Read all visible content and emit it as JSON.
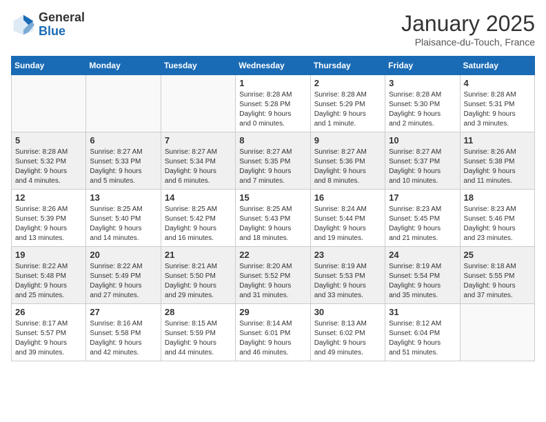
{
  "header": {
    "logo_general": "General",
    "logo_blue": "Blue",
    "month_title": "January 2025",
    "location": "Plaisance-du-Touch, France"
  },
  "days_of_week": [
    "Sunday",
    "Monday",
    "Tuesday",
    "Wednesday",
    "Thursday",
    "Friday",
    "Saturday"
  ],
  "weeks": [
    [
      {
        "day": "",
        "content": ""
      },
      {
        "day": "",
        "content": ""
      },
      {
        "day": "",
        "content": ""
      },
      {
        "day": "1",
        "content": "Sunrise: 8:28 AM\nSunset: 5:28 PM\nDaylight: 9 hours\nand 0 minutes."
      },
      {
        "day": "2",
        "content": "Sunrise: 8:28 AM\nSunset: 5:29 PM\nDaylight: 9 hours\nand 1 minute."
      },
      {
        "day": "3",
        "content": "Sunrise: 8:28 AM\nSunset: 5:30 PM\nDaylight: 9 hours\nand 2 minutes."
      },
      {
        "day": "4",
        "content": "Sunrise: 8:28 AM\nSunset: 5:31 PM\nDaylight: 9 hours\nand 3 minutes."
      }
    ],
    [
      {
        "day": "5",
        "content": "Sunrise: 8:28 AM\nSunset: 5:32 PM\nDaylight: 9 hours\nand 4 minutes."
      },
      {
        "day": "6",
        "content": "Sunrise: 8:27 AM\nSunset: 5:33 PM\nDaylight: 9 hours\nand 5 minutes."
      },
      {
        "day": "7",
        "content": "Sunrise: 8:27 AM\nSunset: 5:34 PM\nDaylight: 9 hours\nand 6 minutes."
      },
      {
        "day": "8",
        "content": "Sunrise: 8:27 AM\nSunset: 5:35 PM\nDaylight: 9 hours\nand 7 minutes."
      },
      {
        "day": "9",
        "content": "Sunrise: 8:27 AM\nSunset: 5:36 PM\nDaylight: 9 hours\nand 8 minutes."
      },
      {
        "day": "10",
        "content": "Sunrise: 8:27 AM\nSunset: 5:37 PM\nDaylight: 9 hours\nand 10 minutes."
      },
      {
        "day": "11",
        "content": "Sunrise: 8:26 AM\nSunset: 5:38 PM\nDaylight: 9 hours\nand 11 minutes."
      }
    ],
    [
      {
        "day": "12",
        "content": "Sunrise: 8:26 AM\nSunset: 5:39 PM\nDaylight: 9 hours\nand 13 minutes."
      },
      {
        "day": "13",
        "content": "Sunrise: 8:25 AM\nSunset: 5:40 PM\nDaylight: 9 hours\nand 14 minutes."
      },
      {
        "day": "14",
        "content": "Sunrise: 8:25 AM\nSunset: 5:42 PM\nDaylight: 9 hours\nand 16 minutes."
      },
      {
        "day": "15",
        "content": "Sunrise: 8:25 AM\nSunset: 5:43 PM\nDaylight: 9 hours\nand 18 minutes."
      },
      {
        "day": "16",
        "content": "Sunrise: 8:24 AM\nSunset: 5:44 PM\nDaylight: 9 hours\nand 19 minutes."
      },
      {
        "day": "17",
        "content": "Sunrise: 8:23 AM\nSunset: 5:45 PM\nDaylight: 9 hours\nand 21 minutes."
      },
      {
        "day": "18",
        "content": "Sunrise: 8:23 AM\nSunset: 5:46 PM\nDaylight: 9 hours\nand 23 minutes."
      }
    ],
    [
      {
        "day": "19",
        "content": "Sunrise: 8:22 AM\nSunset: 5:48 PM\nDaylight: 9 hours\nand 25 minutes."
      },
      {
        "day": "20",
        "content": "Sunrise: 8:22 AM\nSunset: 5:49 PM\nDaylight: 9 hours\nand 27 minutes."
      },
      {
        "day": "21",
        "content": "Sunrise: 8:21 AM\nSunset: 5:50 PM\nDaylight: 9 hours\nand 29 minutes."
      },
      {
        "day": "22",
        "content": "Sunrise: 8:20 AM\nSunset: 5:52 PM\nDaylight: 9 hours\nand 31 minutes."
      },
      {
        "day": "23",
        "content": "Sunrise: 8:19 AM\nSunset: 5:53 PM\nDaylight: 9 hours\nand 33 minutes."
      },
      {
        "day": "24",
        "content": "Sunrise: 8:19 AM\nSunset: 5:54 PM\nDaylight: 9 hours\nand 35 minutes."
      },
      {
        "day": "25",
        "content": "Sunrise: 8:18 AM\nSunset: 5:55 PM\nDaylight: 9 hours\nand 37 minutes."
      }
    ],
    [
      {
        "day": "26",
        "content": "Sunrise: 8:17 AM\nSunset: 5:57 PM\nDaylight: 9 hours\nand 39 minutes."
      },
      {
        "day": "27",
        "content": "Sunrise: 8:16 AM\nSunset: 5:58 PM\nDaylight: 9 hours\nand 42 minutes."
      },
      {
        "day": "28",
        "content": "Sunrise: 8:15 AM\nSunset: 5:59 PM\nDaylight: 9 hours\nand 44 minutes."
      },
      {
        "day": "29",
        "content": "Sunrise: 8:14 AM\nSunset: 6:01 PM\nDaylight: 9 hours\nand 46 minutes."
      },
      {
        "day": "30",
        "content": "Sunrise: 8:13 AM\nSunset: 6:02 PM\nDaylight: 9 hours\nand 49 minutes."
      },
      {
        "day": "31",
        "content": "Sunrise: 8:12 AM\nSunset: 6:04 PM\nDaylight: 9 hours\nand 51 minutes."
      },
      {
        "day": "",
        "content": ""
      }
    ]
  ]
}
